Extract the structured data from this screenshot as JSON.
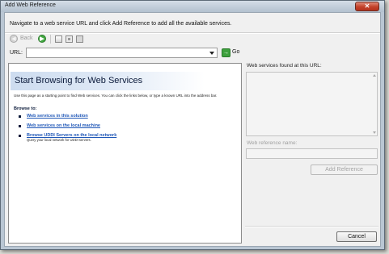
{
  "window": {
    "title": "Add Web Reference",
    "close_glyph": "✕"
  },
  "instruction": "Navigate to a web service URL and click Add Reference to add all the available services.",
  "toolbar": {
    "back_label": "Back",
    "back_glyph": "◀",
    "forward_glyph": "▶",
    "icons": [
      "back-icon",
      "forward-icon",
      "home-icon",
      "stop-icon",
      "refresh-icon"
    ]
  },
  "url": {
    "label": "URL:",
    "value": "",
    "go_label": "Go",
    "go_glyph": "→"
  },
  "browser": {
    "title": "Start Browsing for Web Services",
    "intro": "Use this page as a starting point to find Web services. You can click the links below, or type a known URL into the address bar.",
    "browse_to": "Browse to:",
    "links": [
      {
        "label": "Web services in this solution",
        "description": ""
      },
      {
        "label": "Web services on the local machine",
        "description": ""
      },
      {
        "label": "Browse UDDI Servers on the local network",
        "description": "Query your local network for UDDI servers."
      }
    ]
  },
  "right_panel": {
    "found_label": "Web services found at this URL:",
    "reference_name_label": "Web reference name:",
    "reference_name_value": "",
    "add_reference_label": "Add Reference"
  },
  "footer": {
    "cancel_label": "Cancel"
  },
  "colors": {
    "title_bar": "#c3cfdb",
    "close_button": "#c2412a",
    "link": "#1f57b7",
    "go_green": "#3ea13e"
  }
}
